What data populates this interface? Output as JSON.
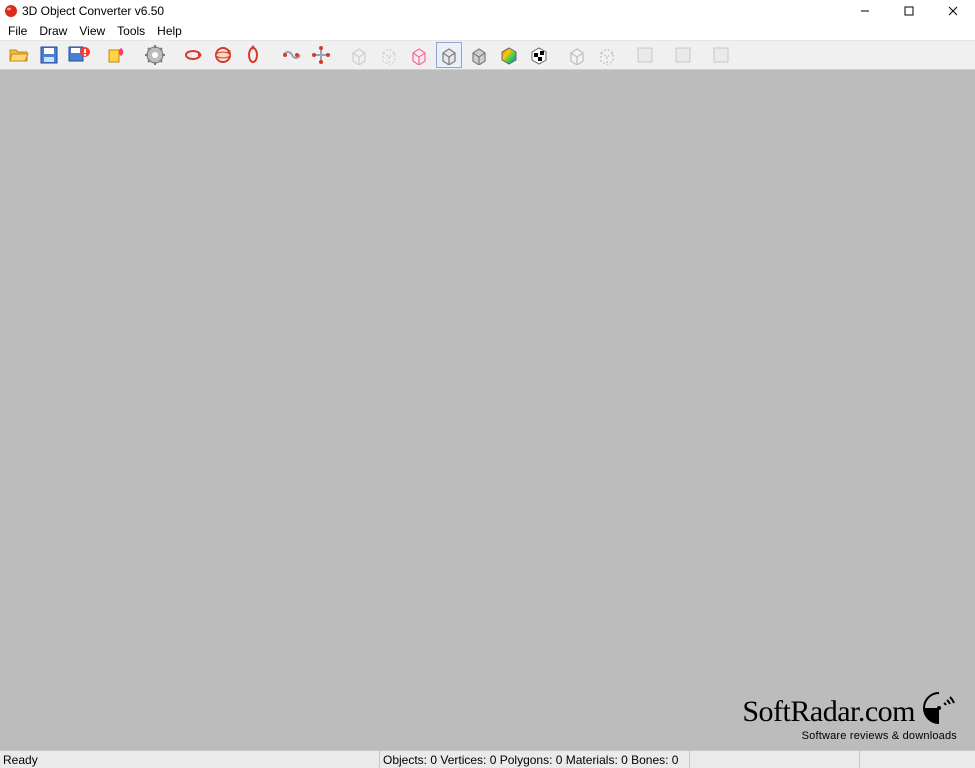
{
  "title": "3D Object Converter v6.50",
  "menu": [
    "File",
    "Draw",
    "View",
    "Tools",
    "Help"
  ],
  "status": {
    "ready": "Ready",
    "stats": "Objects: 0   Vertices: 0   Polygons: 0   Materials: 0   Bones: 0"
  },
  "watermark": {
    "line1": "SoftRadar.com",
    "line2": "Software reviews & downloads"
  },
  "toolbar": [
    {
      "name": "open-icon"
    },
    {
      "name": "save-icon"
    },
    {
      "name": "save-as-icon"
    },
    {
      "sep": true
    },
    {
      "name": "favorite-icon"
    },
    {
      "sep": true
    },
    {
      "name": "settings-icon"
    },
    {
      "sep": true
    },
    {
      "name": "rotate-x-icon"
    },
    {
      "name": "rotate-y-icon"
    },
    {
      "name": "rotate-z-icon"
    },
    {
      "sep": true
    },
    {
      "name": "tool-a-icon"
    },
    {
      "name": "tool-b-icon"
    },
    {
      "sep": true
    },
    {
      "name": "wireframe-1-icon"
    },
    {
      "name": "wireframe-2-icon"
    },
    {
      "name": "wireframe-3-icon"
    },
    {
      "name": "shaded-1-icon",
      "selected": true
    },
    {
      "name": "shaded-2-icon"
    },
    {
      "name": "color-gradient-icon"
    },
    {
      "name": "checker-icon"
    },
    {
      "sep": true
    },
    {
      "name": "view-a-icon"
    },
    {
      "name": "view-b-icon"
    },
    {
      "sep": true
    },
    {
      "name": "misc-a-icon"
    },
    {
      "sep": true
    },
    {
      "name": "misc-b-icon"
    },
    {
      "sep": true
    },
    {
      "name": "misc-c-icon"
    }
  ]
}
